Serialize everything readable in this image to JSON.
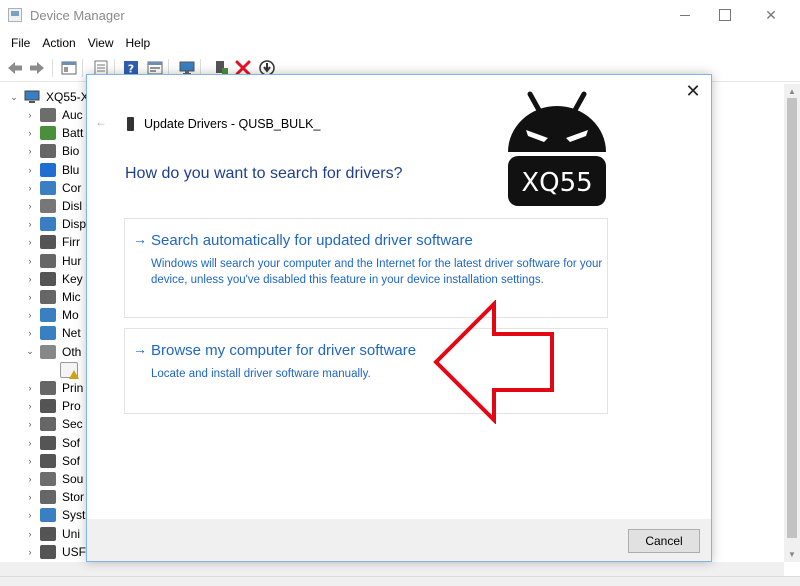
{
  "window": {
    "title": "Device Manager",
    "menu": [
      "File",
      "Action",
      "View",
      "Help"
    ]
  },
  "toolbar": {
    "icons": [
      "back-arrow-icon",
      "forward-arrow-icon",
      "properties-icon",
      "list-view-icon",
      "help-icon",
      "view-icon",
      "scan-hardware-icon",
      "update-driver-icon",
      "uninstall-icon",
      "disable-icon"
    ],
    "colors": {
      "uninstall": "#e81123"
    }
  },
  "tree": {
    "root": "XQ55-X",
    "items": [
      {
        "label": "Auc",
        "icon": "speaker-icon",
        "color": "#6d6d6d"
      },
      {
        "label": "Batt",
        "icon": "battery-icon",
        "color": "#4a8f3a"
      },
      {
        "label": "Bio",
        "icon": "fingerprint-icon",
        "color": "#666666"
      },
      {
        "label": "Blu",
        "icon": "bluetooth-icon",
        "color": "#1e6fd0"
      },
      {
        "label": "Cor",
        "icon": "computer-icon",
        "color": "#3a7fc1"
      },
      {
        "label": "Disl",
        "icon": "disk-drive-icon",
        "color": "#777777"
      },
      {
        "label": "Disp",
        "icon": "monitor-icon",
        "color": "#3a7fc1"
      },
      {
        "label": "Firr",
        "icon": "firmware-icon",
        "color": "#555555"
      },
      {
        "label": "Hur",
        "icon": "hid-icon",
        "color": "#666666"
      },
      {
        "label": "Key",
        "icon": "keyboard-icon",
        "color": "#555555"
      },
      {
        "label": "Mic",
        "icon": "mouse-icon",
        "color": "#666666"
      },
      {
        "label": "Mo",
        "icon": "monitor-icon",
        "color": "#3a7fc1"
      },
      {
        "label": "Net",
        "icon": "network-icon",
        "color": "#3a7fc1"
      },
      {
        "label": "Oth",
        "icon": "other-devices-icon",
        "color": "#888888",
        "expanded": true
      },
      {
        "label": "",
        "icon": "unknown-device-warning-icon",
        "color": "#d4a017",
        "child": true
      },
      {
        "label": "Prin",
        "icon": "printer-icon",
        "color": "#666666"
      },
      {
        "label": "Pro",
        "icon": "processor-icon",
        "color": "#555555"
      },
      {
        "label": "Sec",
        "icon": "security-icon",
        "color": "#666666"
      },
      {
        "label": "Sof",
        "icon": "software-component-icon",
        "color": "#555555"
      },
      {
        "label": "Sof",
        "icon": "software-device-icon",
        "color": "#555555"
      },
      {
        "label": "Sou",
        "icon": "sound-icon",
        "color": "#6d6d6d"
      },
      {
        "label": "Stor",
        "icon": "storage-icon",
        "color": "#666666"
      },
      {
        "label": "Syst",
        "icon": "system-icon",
        "color": "#3a7fc1"
      },
      {
        "label": "Uni",
        "icon": "usb-icon",
        "color": "#555555"
      },
      {
        "label": "USF",
        "icon": "usb-icon",
        "color": "#555555"
      }
    ]
  },
  "dialog": {
    "title": "Update Drivers - QUSB_BULK_",
    "heading": "How do you want to search for drivers?",
    "option_auto": {
      "title": "Search automatically for updated driver software",
      "desc": "Windows will search your computer and the Internet for the latest driver software for your device, unless you've disabled this feature in your device installation settings."
    },
    "option_browse": {
      "title": "Browse my computer for driver software",
      "desc": "Locate and install driver software manually."
    },
    "cancel_label": "Cancel",
    "link_color": "#1f66c5",
    "heading_color": "#1e3f8a"
  },
  "overlay": {
    "logo_text": "XQ55",
    "logo_icon": "android-robot-logo-icon",
    "pointer": "red-arrow-pointer-icon",
    "pointer_color": "#e30613"
  }
}
